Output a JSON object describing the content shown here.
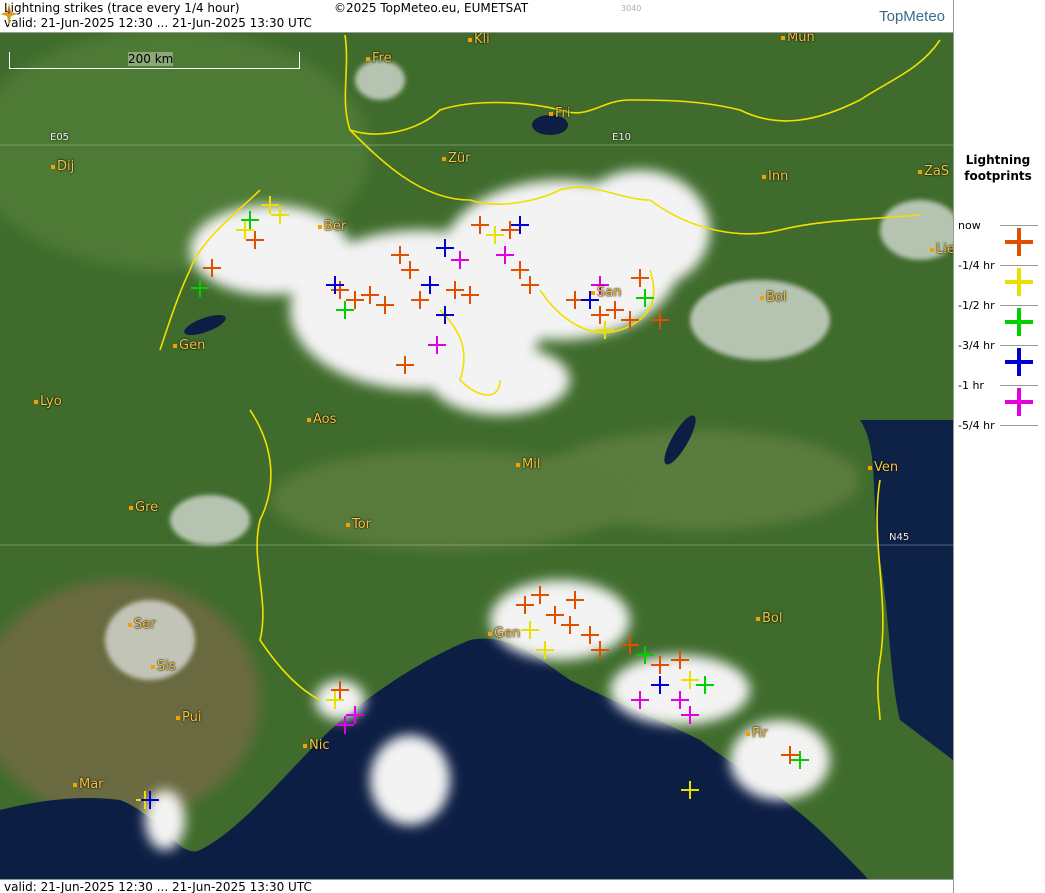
{
  "header": {
    "title": "Lightning strikes (trace every 1/4 hour)",
    "copyright": "©2025 TopMeteo.eu, EUMETSAT",
    "valid": "valid:  21-Jun-2025 12:30 ... 21-Jun-2025 13:30 UTC",
    "code": "3040",
    "logo": "TopMeteo"
  },
  "footer": {
    "valid": "valid:  21-Jun-2025 12:30 ... 21-Jun-2025 13:30 UTC"
  },
  "scale_label": "200 km",
  "grid_labels": {
    "e05": "E05",
    "e10": "E10",
    "n45": "N45"
  },
  "cities": [
    "Kli",
    "Mun",
    "Fre",
    "Fri",
    "Dij",
    "Zür",
    "Inn",
    "ZaS",
    "Ber",
    "Lie",
    "Bol",
    "Gen",
    "Lyo",
    "Aos",
    "Mil",
    "Ven",
    "Gre",
    "Tor",
    "Ser",
    "Bol",
    "Gen",
    "Sis",
    "Pui",
    "Nic",
    "Fir",
    "Mar",
    "San"
  ],
  "legend": {
    "title_line1": "Lightning",
    "title_line2": "footprints",
    "rows": [
      {
        "label": "now",
        "color": "#e05000"
      },
      {
        "label": "-1/4 hr",
        "color": "#e8e000"
      },
      {
        "label": "-1/2 hr",
        "color": "#00d000"
      },
      {
        "label": "-3/4 hr",
        "color": "#0000d0"
      },
      {
        "label": "-1 hr",
        "color": "#e000e0"
      },
      {
        "label": "-5/4 hr",
        "color": ""
      }
    ]
  },
  "colors": {
    "sea": "#0d1e44",
    "land": "#3d6a2a",
    "border": "#f0e000",
    "cloud": "#f3f3f3"
  }
}
